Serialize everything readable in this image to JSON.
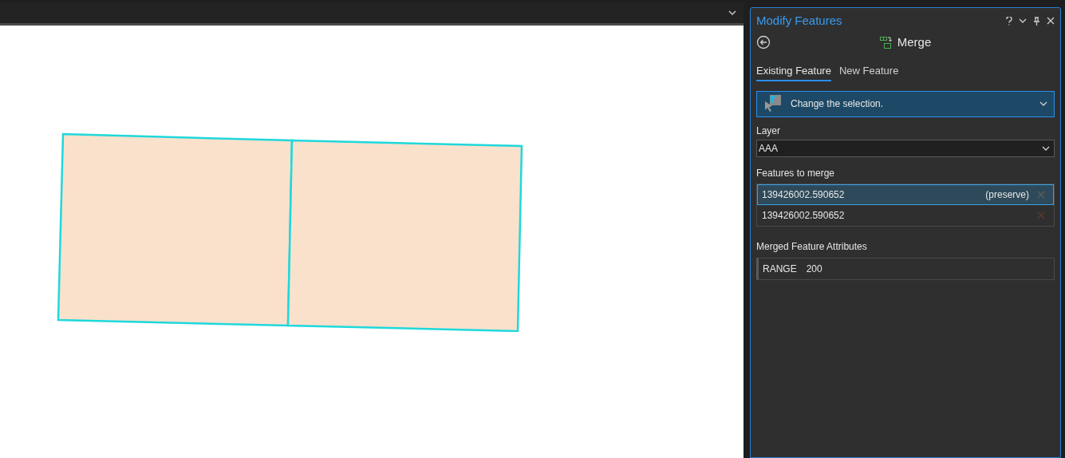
{
  "pane": {
    "title": "Modify Features",
    "tool": "Merge"
  },
  "tabs": [
    {
      "label": "Existing Feature",
      "selected": true
    },
    {
      "label": "New Feature",
      "selected": false
    }
  ],
  "selection_dropdown": {
    "value": "Change the selection."
  },
  "layer": {
    "label": "Layer",
    "value": "AAA"
  },
  "features_to_merge": {
    "label": "Features to merge",
    "items": [
      {
        "id": "139426002.590652",
        "note": "(preserve)",
        "selected": true
      },
      {
        "id": "139426002.590652",
        "selected": false
      }
    ]
  },
  "merged_attributes": {
    "label": "Merged Feature Attributes",
    "field": "RANGE",
    "value": "200"
  }
}
